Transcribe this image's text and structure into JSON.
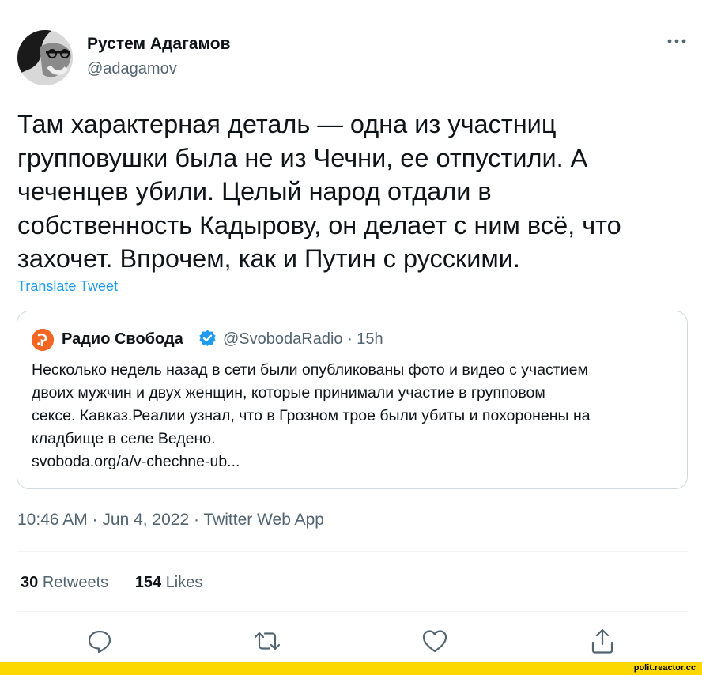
{
  "author": {
    "name": "Рустем Адагамов",
    "handle": "@adagamov"
  },
  "tweet": {
    "text": "Там характерная деталь — одна из участниц\nгрупповушки была не из Чечни, ее отпустили. А\nчеченцев убили. Целый народ отдали в\nсобственность Кадырову, он делает с ним всё, что\nзахочет. Впрочем, как и Путин с русскими.",
    "translate_label": "Translate Tweet",
    "timestamp": "10:46 AM · Jun 4, 2022 · Twitter Web App"
  },
  "quote": {
    "name": "Радио Свобода",
    "handle_time": "@SvobodaRadio · 15h",
    "text": "Несколько недель назад в сети были опубликованы фото и видео с участием\nдвоих мужчин и двух женщин, которые принимали участие в групповом\nсексе. Кавказ.Реалии узнал, что в Грозном трое были убиты и похоронены на\nкладбище в селе Ведено.\nsvoboda.org/a/v-chechne-ub..."
  },
  "stats": {
    "retweets_count": "30",
    "retweets_label": "Retweets",
    "likes_count": "154",
    "likes_label": "Likes"
  },
  "actions": [
    {
      "name": "reply",
      "icon": "reply-icon"
    },
    {
      "name": "retweet",
      "icon": "retweet-icon"
    },
    {
      "name": "like",
      "icon": "heart-icon"
    },
    {
      "name": "share",
      "icon": "share-icon"
    }
  ],
  "watermark": "polit.reactor.cc",
  "colors": {
    "text": "#0f1419",
    "secondary": "#536471",
    "link": "#1d9bf0",
    "verified": "#1d9bf0",
    "svoboda_logo": "#f26522",
    "watermark_bar": "#fdd800"
  }
}
